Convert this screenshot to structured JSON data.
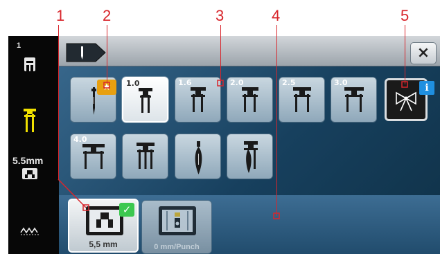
{
  "callouts": [
    "1",
    "2",
    "3",
    "4",
    "5"
  ],
  "left_bar": {
    "page_number": "1",
    "page_icon": "presser-foot-icon",
    "needle_icon": "double-needle-icon",
    "width_value": "5.5mm",
    "plate_icon": "stitch-plate-icon",
    "stitch_icon": "zigzag-stitch-icon"
  },
  "top_bar": {
    "mode_icon": "needle-tab-icon",
    "close_glyph": "×"
  },
  "needles": [
    {
      "id": "single",
      "size": "",
      "type": "single",
      "favorite": true
    },
    {
      "id": "twin-1-0",
      "size": "1.0",
      "type": "twin",
      "selected": true
    },
    {
      "id": "twin-1-6",
      "size": "1.6",
      "type": "twin"
    },
    {
      "id": "twin-2-0",
      "size": "2.0",
      "type": "twin"
    },
    {
      "id": "twin-2-5",
      "size": "2.5",
      "type": "twin"
    },
    {
      "id": "twin-3-0",
      "size": "3.0",
      "type": "twin"
    },
    {
      "id": "twin-4-0",
      "size": "4.0",
      "type": "twin"
    },
    {
      "id": "triple",
      "size": "",
      "type": "triple"
    },
    {
      "id": "wing",
      "size": "",
      "type": "wing"
    },
    {
      "id": "double-wing",
      "size": "",
      "type": "double-wing"
    }
  ],
  "info_button": {
    "icon": "bow-tie-icon",
    "badge": "i"
  },
  "favorite_badge": "★",
  "stitch_plates": [
    {
      "label": "5,5 mm",
      "active": true,
      "checked": true,
      "check_glyph": "✓"
    },
    {
      "label": "0 mm/Punch",
      "active": false
    }
  ],
  "colors": {
    "callout": "#d8262c",
    "panel_dark": "#0f3147",
    "panel_light": "#3a6a8f",
    "accent_yellow": "#f0e000",
    "favorite_orange": "#e8a010",
    "info_blue": "#1f8fe0",
    "check_green": "#3cc850"
  }
}
